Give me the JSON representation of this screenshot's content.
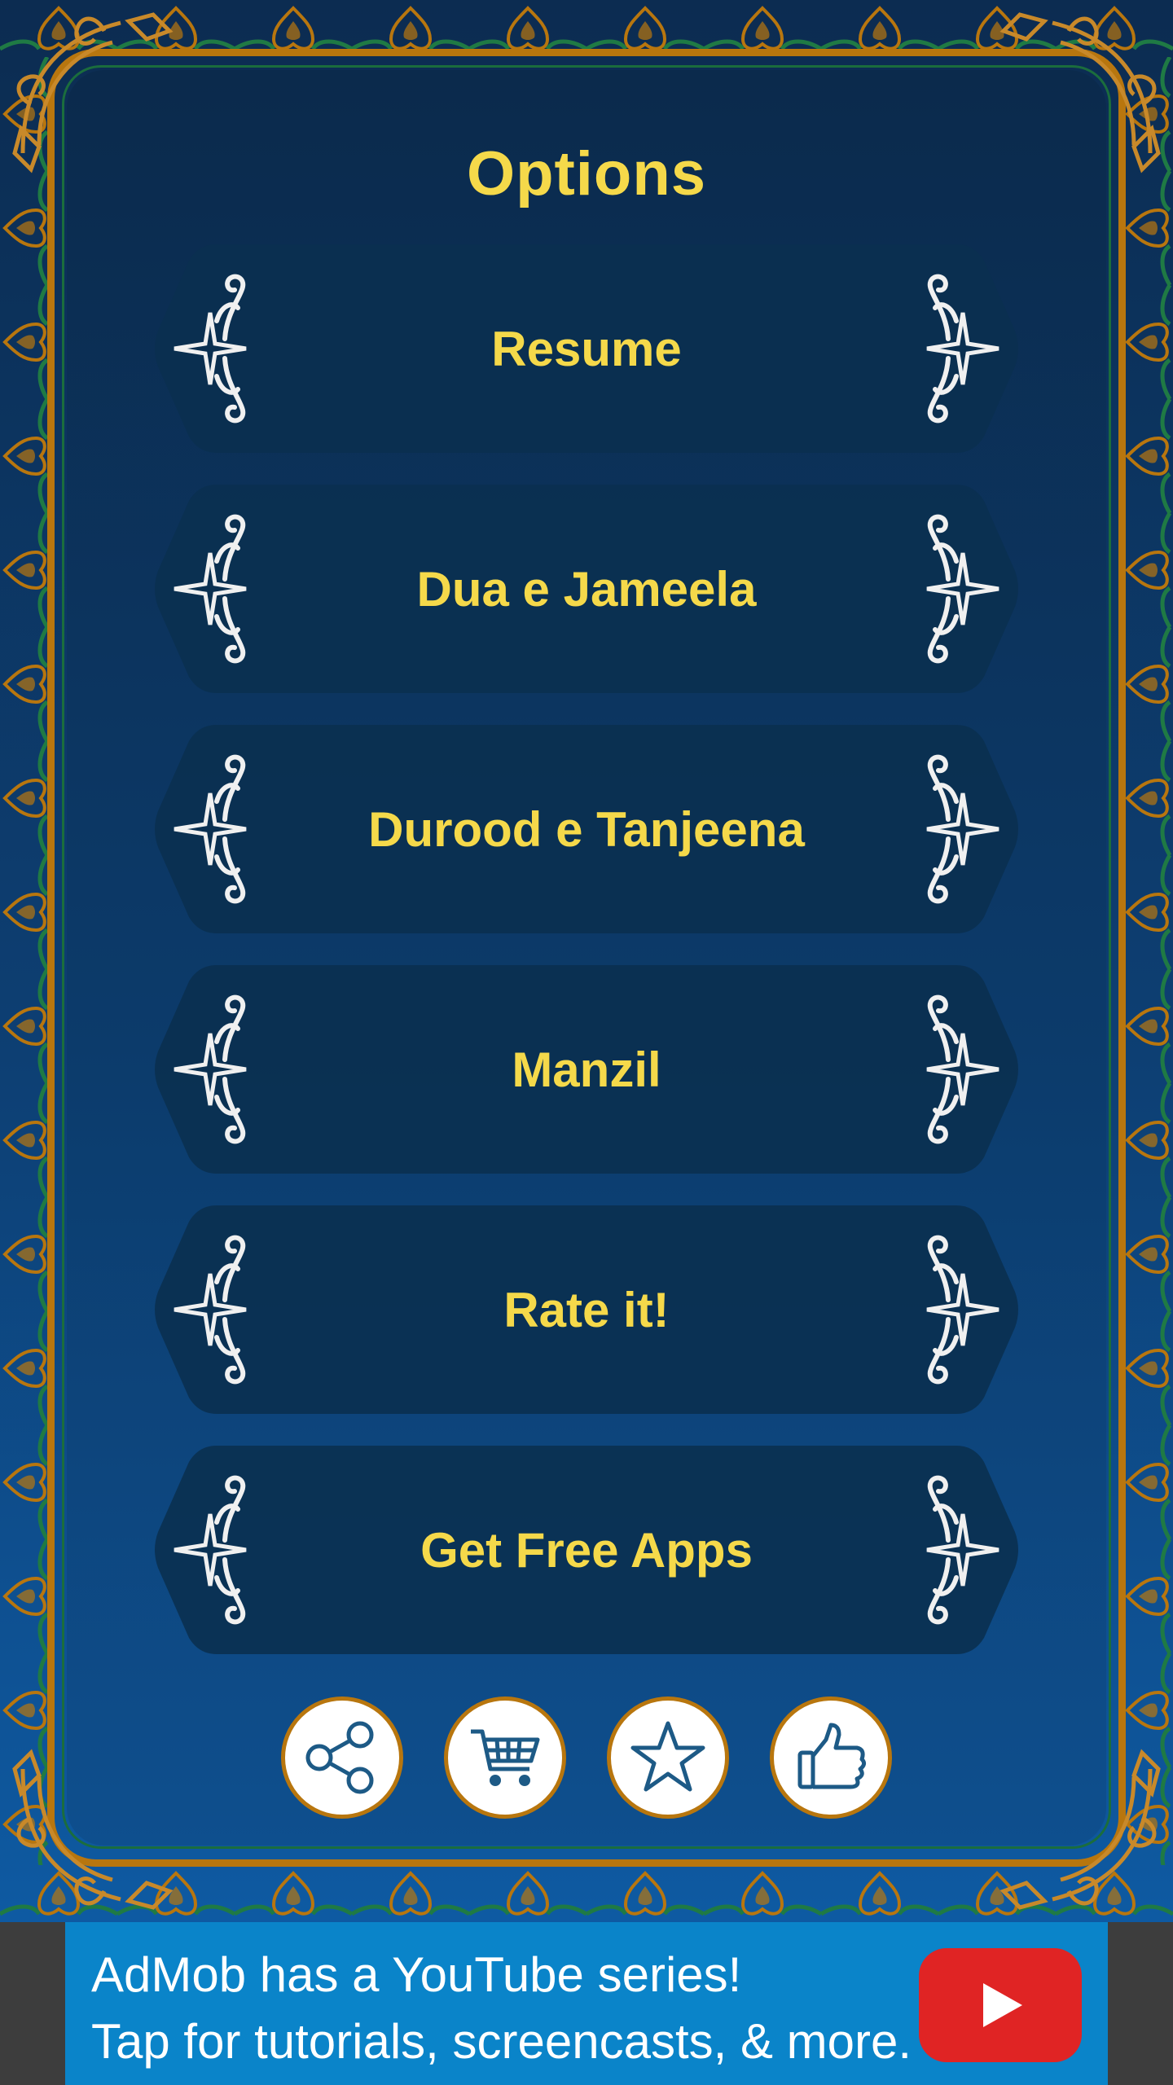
{
  "screen": {
    "title": "Options"
  },
  "menu": [
    {
      "label": "Resume",
      "name": "resume-button"
    },
    {
      "label": "Dua e Jameela",
      "name": "dua-e-jameela-button"
    },
    {
      "label": "Durood e Tanjeena",
      "name": "durood-e-tanjeena-button"
    },
    {
      "label": "Manzil",
      "name": "manzil-button"
    },
    {
      "label": "Rate it!",
      "name": "rate-it-button"
    },
    {
      "label": "Get Free Apps",
      "name": "get-free-apps-button"
    }
  ],
  "action_icons": [
    "share-icon",
    "cart-icon",
    "star-icon",
    "thumbs-up-icon"
  ],
  "ad": {
    "line1": "AdMob has a YouTube series!",
    "line2": "Tap for tutorials, screencasts, & more.",
    "icon": "youtube-play-icon"
  },
  "colors": {
    "accent_text": "#f5d94a",
    "frame_gold": "#b8760e",
    "button_fill": "#0a3050",
    "ad_blue": "#0a84c9",
    "youtube_red": "#e02424"
  }
}
